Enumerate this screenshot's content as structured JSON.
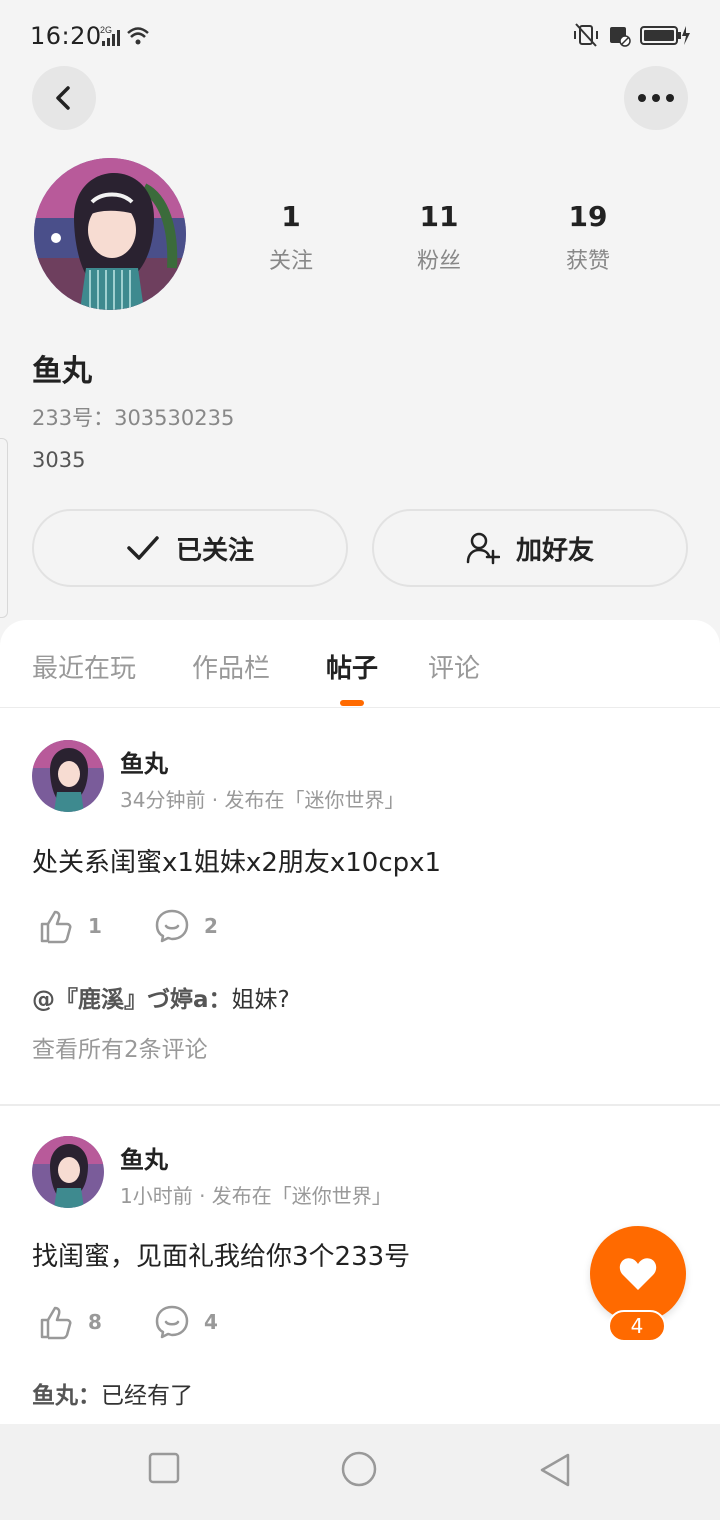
{
  "status_bar": {
    "time": "16:20",
    "network": "2G",
    "icons": [
      "signal-icon",
      "wifi-icon",
      "vibrate-icon",
      "battery-icon"
    ]
  },
  "profile": {
    "avatar": "avatar-image",
    "name": "鱼丸",
    "uid_label": "233号：303530235",
    "bio": "3035",
    "stats": [
      {
        "value": "1",
        "label": "关注"
      },
      {
        "value": "11",
        "label": "粉丝"
      },
      {
        "value": "19",
        "label": "获赞"
      }
    ],
    "follow_label": "已关注",
    "add_friend_label": "加好友"
  },
  "tabs": [
    {
      "label": "最近在玩",
      "active": false
    },
    {
      "label": "作品栏",
      "active": false
    },
    {
      "label": "帖子",
      "active": true
    },
    {
      "label": "评论",
      "active": false
    }
  ],
  "posts": [
    {
      "author": "鱼丸",
      "meta": "34分钟前 · 发布在「迷你世界」",
      "text": "处关系闺蜜x1姐妹x2朋友x10cpx1",
      "likes": "1",
      "comments": "2",
      "top_comment_author": "@『鹿溪』づ婷a：",
      "top_comment_text": "姐妹?",
      "view_all": "查看所有2条评论"
    },
    {
      "author": "鱼丸",
      "meta": "1小时前 · 发布在「迷你世界」",
      "text": "找闺蜜，见面礼我给你3个233号",
      "likes": "8",
      "comments": "4",
      "top_comment_author": "鱼丸：",
      "top_comment_text": "已经有了"
    }
  ],
  "fab": {
    "count": "4"
  },
  "colors": {
    "accent": "#ff6a00",
    "background": "#f4f4f4"
  }
}
